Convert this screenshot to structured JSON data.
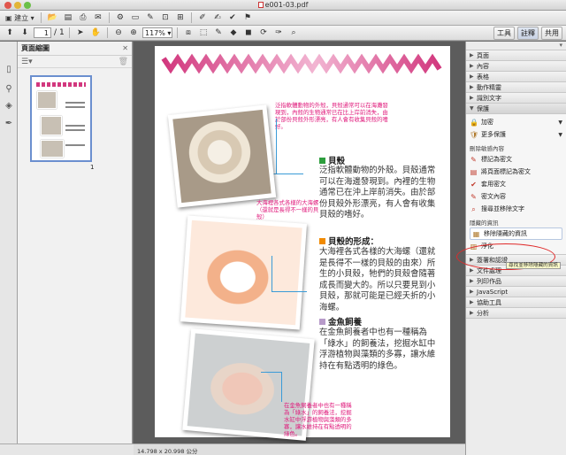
{
  "window": {
    "title": "e001-03.pdf"
  },
  "toolbar1": {
    "create_label": "建立",
    "buttons": [
      "open-icon",
      "save-icon",
      "print-icon",
      "email-icon",
      "settings-icon",
      "comment-icon",
      "highlight-icon",
      "stamp-icon",
      "sign-icon",
      "sign-pen-icon",
      "sign-fill-icon",
      "flag-icon"
    ]
  },
  "toolbar2": {
    "page_current": "1",
    "page_sep": "/",
    "page_total": "1",
    "zoom_value": "117%",
    "links": {
      "tools": "工具",
      "comment": "註釋",
      "share": "共用"
    }
  },
  "thumbnails": {
    "title": "頁面縮圖",
    "page_number": "1"
  },
  "document": {
    "note1": "泛指軟體動物的外殼，貝殼通常可以在海灘發現到，內殼的生物通常已在比上岸前消失，由於部份貝殼外形漂亮，有人會有收集貝殼的嗜好。",
    "note2": "大海裡各式各樣的大海螺（還就是長得不一樣的貝殼）",
    "note3": "在金魚飼養者中也有一種稱為「綠水」的飼養法，挖掘水缸中浮游植物與藻類的多寡，讓水維持在有點透明的綠色。",
    "heading1": "貝殼",
    "body1": "泛指軟體動物的外殼。貝殼通常可以在海邊發現到。內裡的生物通常已在沖上岸前消失。由於部份貝殼外形漂亮，有人會有收集貝殼的嗜好。",
    "heading2": "貝殼的形成：",
    "body2": "大海裡各式各樣的大海螺（還就是長得不一樣的貝殼的由來）所生的小貝殼，牠們的貝殼會隨著成長而變大的。所以只要見到小貝殼，那就可能是已經夭折的小海螺。",
    "heading3": "金魚飼養",
    "body3": "在金魚飼養者中也有一種稱為「綠水」的飼養法，挖掘水缸中浮游植物與藻類的多寡，讓水維持在有點透明的綠色。",
    "colors": {
      "heading1": "#2e9e3e",
      "heading2": "#f08a00",
      "heading3": "#b79ac9",
      "accent": "#e0197b"
    }
  },
  "status": {
    "page_size": "14.798 x 20.998 公分"
  },
  "rightpanel": {
    "sections_top": [
      "頁面",
      "內容",
      "表格",
      "動作精靈",
      "識別文字"
    ],
    "protect_label": "保護",
    "encrypt_label": "加密",
    "more_protect_label": "更多保護",
    "redact_head": "刪除敏感內容",
    "redact_items": [
      "標記為密文",
      "將頁面標記為密文",
      "套用密文",
      "密文內容",
      "搜尋並移除文字"
    ],
    "hidden_head": "隱藏的資訊",
    "remove_hidden": "移除隱藏的資訊",
    "partial_item": "淨化",
    "tooltip": "尋找並移除隱藏的資訊",
    "sections_bottom": [
      "簽署和認證",
      "文件處理",
      "列印作品",
      "JavaScript",
      "協助工具",
      "分析"
    ]
  }
}
